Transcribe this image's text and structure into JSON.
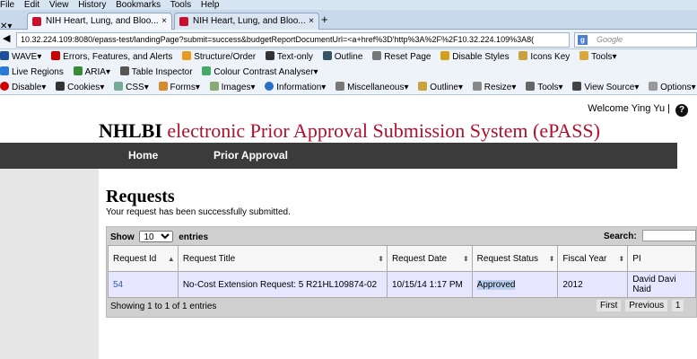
{
  "browser": {
    "menu": [
      "File",
      "Edit",
      "View",
      "History",
      "Bookmarks",
      "Tools",
      "Help"
    ],
    "tabs": [
      {
        "title": "NIH Heart, Lung, and Bloo..."
      },
      {
        "title": "NIH Heart, Lung, and Bloo..."
      }
    ],
    "new_tab": "+",
    "url": "10.32.224.109:8080/epass-test/landingPage?submit=success&budgetReportDocumentUrl=<a+href%3D'http%3A%2F%2F10.32.224.109%3A8(",
    "search_placeholder": "Google",
    "toolbar1": [
      "WAVE",
      "Errors, Features, and Alerts",
      "Structure/Order",
      "Text-only",
      "Outline",
      "Reset Page",
      "Disable Styles",
      "Icons Key",
      "Tools"
    ],
    "toolbar2": [
      "Live Regions",
      "ARIA",
      "Table Inspector",
      "Colour Contrast Analyser"
    ],
    "toolbar3": [
      "Disable",
      "Cookies",
      "CSS",
      "Forms",
      "Images",
      "Information",
      "Miscellaneous",
      "Outline",
      "Resize",
      "Tools",
      "View Source",
      "Options"
    ]
  },
  "header": {
    "welcome": "Welcome Ying Yu  |",
    "help": "?",
    "title_short": "NHLBI",
    "title_rest": "electronic Prior Approval Submission System (ePASS)"
  },
  "nav": {
    "home": "Home",
    "prior_approval": "Prior Approval"
  },
  "requests": {
    "heading": "Requests",
    "message": "Your request has been successfully submitted.",
    "show_label": "Show",
    "entries_value": "10",
    "entries_label": "entries",
    "search_label": "Search:",
    "columns": [
      "Request Id",
      "Request Title",
      "Request Date",
      "Request Status",
      "Fiscal Year",
      "PI"
    ],
    "rows": [
      {
        "id": "54",
        "title": "No-Cost Extension Request: 5 R21HL109874-02",
        "date": "10/15/14 1:17 PM",
        "status": "Approved",
        "fiscal_year": "2012",
        "pi": "David Davi Naid"
      }
    ],
    "footer": "Showing 1 to 1 of 1 entries",
    "pager": [
      "First",
      "Previous",
      "1"
    ]
  }
}
